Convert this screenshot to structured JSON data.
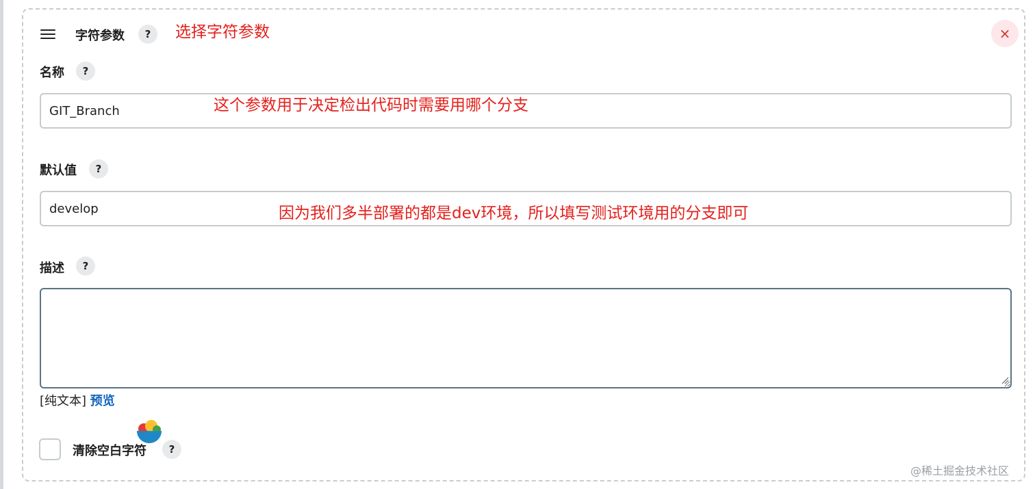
{
  "header": {
    "title": "字符参数",
    "help_label": "?",
    "close_label": "×"
  },
  "fields": {
    "name": {
      "label": "名称",
      "value": "GIT_Branch"
    },
    "default": {
      "label": "默认值",
      "value": "develop"
    },
    "description": {
      "label": "描述",
      "value": ""
    }
  },
  "format": {
    "plain": "[纯文本]",
    "preview": "预览"
  },
  "trim": {
    "label": "清除空白字符",
    "checked": false
  },
  "annotations": {
    "title_note": "选择字符参数",
    "name_note": "这个参数用于决定检出代码时需要用哪个分支",
    "default_note": "因为我们多半部署的都是dev环境，所以填写测试环境用的分支即可"
  },
  "watermark": "@稀土掘金技术社区",
  "colors": {
    "annotation": "#e3211c",
    "link": "#1565c0",
    "close_bg": "#fde7ea",
    "close_fg": "#d32f2f"
  }
}
